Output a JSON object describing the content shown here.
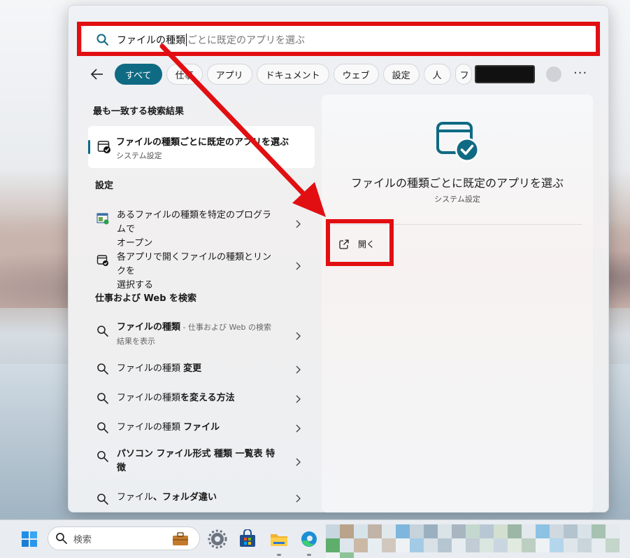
{
  "search": {
    "typed": "ファイルの種類",
    "completion": "ごとに既定のアプリを選ぶ"
  },
  "tabs": [
    {
      "label": "すべて",
      "active": true
    },
    {
      "label": "仕事",
      "active": false
    },
    {
      "label": "アプリ",
      "active": false
    },
    {
      "label": "ドキュメント",
      "active": false
    },
    {
      "label": "ウェブ",
      "active": false
    },
    {
      "label": "設定",
      "active": false
    },
    {
      "label": "人",
      "active": false
    },
    {
      "label": "フ",
      "active": false
    }
  ],
  "left": {
    "best_match_heading": "最も一致する検索結果",
    "best_match": {
      "title": "ファイルの種類ごとに既定のアプリを選ぶ",
      "subtitle": "システム設定"
    },
    "settings_heading": "設定",
    "settings_items": [
      {
        "line1": "あるファイルの種類を特定のプログラムで",
        "line2": "オープン"
      },
      {
        "line1": "各アプリで開くファイルの種類とリンクを",
        "line2": "選択する"
      }
    ],
    "web_heading": "仕事および Web を検索",
    "web_items": [
      {
        "bold": "ファイルの種類",
        "rest": " - 仕事および Web の検索",
        "line2": "結果を表示"
      },
      {
        "plain": "ファイルの種類 ",
        "bold": "変更"
      },
      {
        "plain": "ファイルの種類",
        "bold": "を変える方法"
      },
      {
        "plain": "ファイルの種類 ",
        "bold": "ファイル"
      },
      {
        "bold": "パソコン ファイル形式 種類 一覧表 特",
        "line2": "徴"
      },
      {
        "plain": "ファイル",
        "bold": "、フォルダ違い"
      }
    ]
  },
  "preview": {
    "title": "ファイルの種類ごとに既定のアプリを選ぶ",
    "subtitle": "システム設定",
    "open_label": "開く"
  },
  "taskbar": {
    "search_placeholder": "検索"
  },
  "colors": {
    "accent": "#0f6a83",
    "highlight": "#e10f12"
  }
}
